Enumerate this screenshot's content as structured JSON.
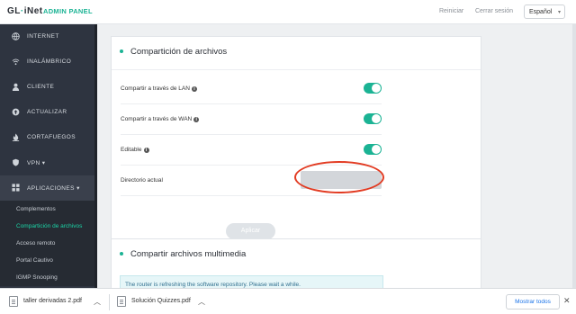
{
  "header": {
    "brand_prefix": "GL",
    "brand_dot": "·",
    "brand_suffix": "iNet",
    "admin_panel": "ADMIN PANEL",
    "reboot": "Reiniciar",
    "logout": "Cerrar sesión",
    "language": "Español",
    "accent_color": "#1bb394"
  },
  "sidebar": {
    "items": [
      {
        "label": "INTERNET",
        "icon": "globe-icon"
      },
      {
        "label": "INALÁMBRICO",
        "icon": "wifi-icon"
      },
      {
        "label": "CLIENTE",
        "icon": "user-icon"
      },
      {
        "label": "ACTUALIZAR",
        "icon": "upgrade-icon"
      },
      {
        "label": "CORTAFUEGOS",
        "icon": "firewall-icon"
      },
      {
        "label": "VPN",
        "icon": "shield-icon",
        "caret": "▾"
      },
      {
        "label": "APLICACIONES",
        "icon": "apps-grid-icon",
        "caret": "▾"
      }
    ],
    "subitems": [
      {
        "label": "Complementos"
      },
      {
        "label": "Compartición de archivos",
        "current": true
      },
      {
        "label": "Acceso remoto"
      },
      {
        "label": "Portal Cautivo"
      },
      {
        "label": "IGMP Snooping"
      }
    ]
  },
  "file_sharing": {
    "title": "Compartición de archivos",
    "share_lan": {
      "label": "Compartir a través de LAN",
      "enabled": true
    },
    "share_wan": {
      "label": "Compartir a través de WAN",
      "enabled": true
    },
    "writable": {
      "label": "Editable",
      "enabled": true
    },
    "current_dir": {
      "label": "Directorio actual",
      "value": ""
    },
    "apply": "Aplicar"
  },
  "media_sharing": {
    "title": "Compartir archivos multimedia",
    "notice": "The router is refreshing the software repository. Please wait a while."
  },
  "downloads": {
    "items": [
      {
        "name": "taller derivadas 2.pdf"
      },
      {
        "name": "Solución Quizzes.pdf"
      }
    ],
    "show_all": "Mostrar todos",
    "close": "✕"
  }
}
